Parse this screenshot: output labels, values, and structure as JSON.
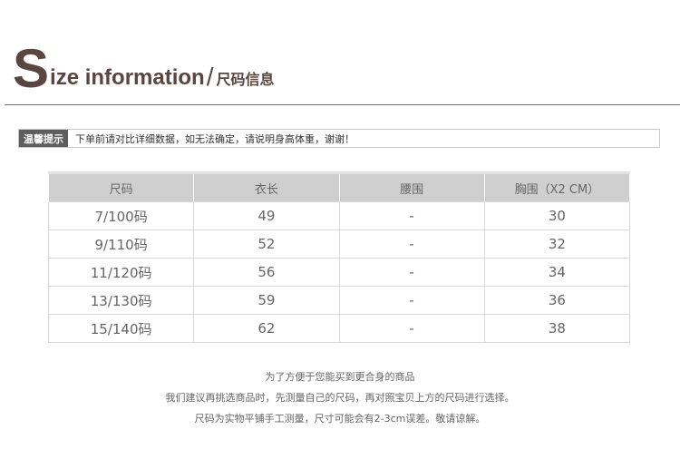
{
  "header": {
    "big_letter": "S",
    "title_rest": "ize information",
    "slash": "/",
    "title_cn": "尺码信息"
  },
  "tip": {
    "label": "温馨提示",
    "text": "下单前请对比详细数据，如无法确定，请说明身高体重，谢谢！"
  },
  "table": {
    "headers": [
      "尺码",
      "衣长",
      "腰围",
      "胸围（X2 CM）"
    ],
    "rows": [
      [
        "7/100码",
        "49",
        "-",
        "30"
      ],
      [
        "9/110码",
        "52",
        "-",
        "32"
      ],
      [
        "11/120码",
        "56",
        "-",
        "34"
      ],
      [
        "13/130码",
        "59",
        "-",
        "36"
      ],
      [
        "15/140码",
        "62",
        "-",
        "38"
      ]
    ]
  },
  "notes": [
    "为了方便于您能买到更合身的商品",
    "我们建议再挑选商品时，先测量自己的尺码，再对照宝贝上方的尺码进行选择。",
    "尺码为实物平铺手工测量，尺寸可能会有2-3cm误差。敬请谅解。"
  ],
  "colors": {
    "title": "#5a4641",
    "tip_label_bg": "#5e5e5e",
    "table_header_bg": "#cfcfcf"
  }
}
